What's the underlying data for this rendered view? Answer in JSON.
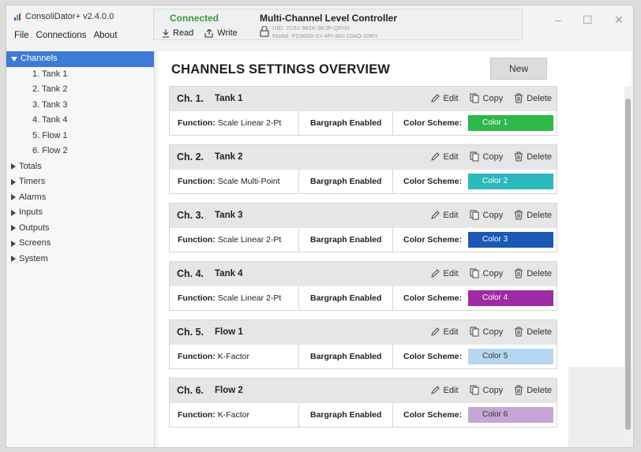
{
  "app": {
    "title": "ConsoliDator+ v2.4.0.0"
  },
  "menu": [
    "File",
    "Connections",
    "About"
  ],
  "connection": {
    "status": "Connected",
    "read_label": "Read",
    "write_label": "Write"
  },
  "device": {
    "title": "Multi-Channel Level Controller",
    "uid": "UID: 7C51-961K-9KJF-QFHX",
    "model": "Model: PD9000-XY-4PI-8AI-10AO-10RY"
  },
  "window_controls": {
    "minimize": "–",
    "maximize": "☐",
    "close": "✕"
  },
  "sidebar": {
    "channels_label": "Channels",
    "channels": [
      "1. Tank 1",
      "2. Tank 2",
      "3. Tank  3",
      "4. Tank 4",
      "5. Flow 1",
      "6. Flow 2"
    ],
    "sections": [
      "Totals",
      "Timers",
      "Alarms",
      "Inputs",
      "Outputs",
      "Screens",
      "System"
    ]
  },
  "main": {
    "title": "CHANNELS SETTINGS OVERVIEW",
    "new_label": "New",
    "edit_label": "Edit",
    "copy_label": "Copy",
    "delete_label": "Delete",
    "function_label": "Function:",
    "color_scheme_label": "Color Scheme:",
    "channels": [
      {
        "num": "Ch. 1.",
        "name": "Tank 1",
        "function": "Scale Linear 2-Pt",
        "bargraph": "Bargraph Enabled",
        "color_name": "Color 1",
        "color": "#2db84a",
        "text_color": "#ffffff"
      },
      {
        "num": "Ch. 2.",
        "name": "Tank 2",
        "function": "Scale Multi-Point",
        "bargraph": "Bargraph Enabled",
        "color_name": "Color 2",
        "color": "#2bb8bd",
        "text_color": "#ffffff"
      },
      {
        "num": "Ch. 3.",
        "name": "Tank  3",
        "function": "Scale Linear 2-Pt",
        "bargraph": "Bargraph Enabled",
        "color_name": "Color 3",
        "color": "#1b58b8",
        "text_color": "#ffffff"
      },
      {
        "num": "Ch. 4.",
        "name": "Tank 4",
        "function": "Scale Linear 2-Pt",
        "bargraph": "Bargraph Enabled",
        "color_name": "Color 4",
        "color": "#a02aa5",
        "text_color": "#ffffff"
      },
      {
        "num": "Ch. 5.",
        "name": "Flow 1",
        "function": "K-Factor",
        "bargraph": "Bargraph Enabled",
        "color_name": "Color 5",
        "color": "#b5d8f2",
        "text_color": "#333333"
      },
      {
        "num": "Ch. 6.",
        "name": "Flow 2",
        "function": "K-Factor",
        "bargraph": "Bargraph Enabled",
        "color_name": "Color 6",
        "color": "#c6a6d6",
        "text_color": "#333333"
      }
    ]
  }
}
